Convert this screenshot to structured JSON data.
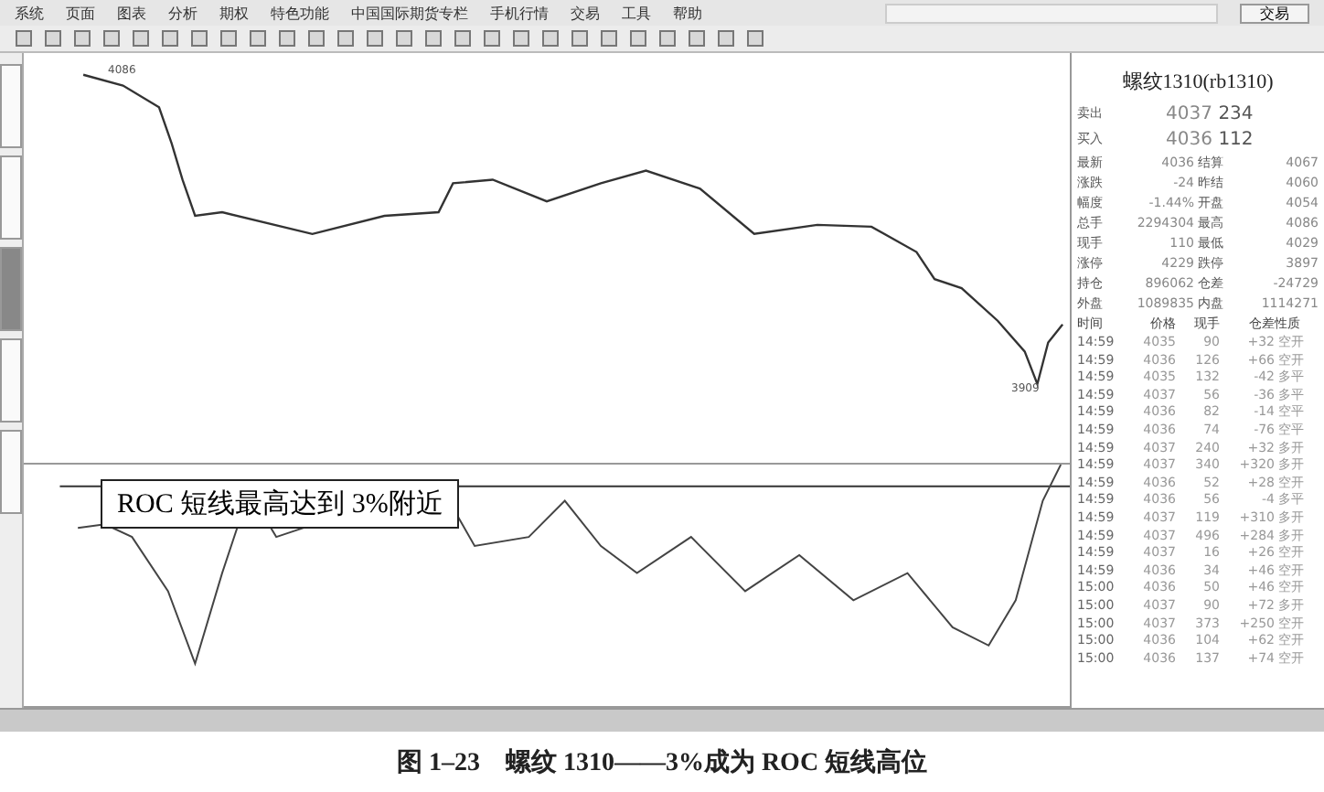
{
  "menu": [
    "系统",
    "页面",
    "图表",
    "分析",
    "期权",
    "特色功能",
    "中国国际期货专栏",
    "手机行情",
    "交易",
    "工具",
    "帮助"
  ],
  "trade_button": "交易",
  "side_tabs": [
    {
      "selected": false
    },
    {
      "selected": false
    },
    {
      "selected": true
    },
    {
      "selected": false
    },
    {
      "selected": false
    }
  ],
  "chart": {
    "high_label": "4086",
    "low_label": "3909",
    "annotation": "ROC 短线最高达到 3%附近"
  },
  "quote": {
    "title": "螺纹1310(rb1310)",
    "asks": [
      {
        "label": "卖出",
        "price": "4037",
        "volume": "234"
      },
      {
        "label": "买入",
        "price": "4036",
        "volume": "112"
      }
    ],
    "fields": [
      [
        "最新",
        "4036",
        "结算",
        "4067"
      ],
      [
        "涨跌",
        "-24",
        "昨结",
        "4060"
      ],
      [
        "幅度",
        "-1.44%",
        "开盘",
        "4054"
      ],
      [
        "总手",
        "2294304",
        "最高",
        "4086"
      ],
      [
        "现手",
        "110",
        "最低",
        "4029"
      ],
      [
        "涨停",
        "4229",
        "跌停",
        "3897"
      ],
      [
        "持仓",
        "896062",
        "仓差",
        "-24729"
      ],
      [
        "外盘",
        "1089835",
        "内盘",
        "1114271"
      ]
    ],
    "trade_columns": [
      "时间",
      "价格",
      "现手",
      "仓差",
      "性质"
    ],
    "trades": [
      [
        "14:59",
        "4035",
        "90",
        "+32",
        "空开"
      ],
      [
        "14:59",
        "4036",
        "126",
        "+66",
        "空开"
      ],
      [
        "14:59",
        "4035",
        "132",
        "-42",
        "多平"
      ],
      [
        "14:59",
        "4037",
        "56",
        "-36",
        "多平"
      ],
      [
        "14:59",
        "4036",
        "82",
        "-14",
        "空平"
      ],
      [
        "14:59",
        "4036",
        "74",
        "-76",
        "空平"
      ],
      [
        "14:59",
        "4037",
        "240",
        "+32",
        "多开"
      ],
      [
        "14:59",
        "4037",
        "340",
        "+320",
        "多开"
      ],
      [
        "14:59",
        "4036",
        "52",
        "+28",
        "空开"
      ],
      [
        "14:59",
        "4036",
        "56",
        "-4",
        "多平"
      ],
      [
        "14:59",
        "4037",
        "119",
        "+310",
        "多开"
      ],
      [
        "14:59",
        "4037",
        "496",
        "+284",
        "多开"
      ],
      [
        "14:59",
        "4037",
        "16",
        "+26",
        "空开"
      ],
      [
        "14:59",
        "4036",
        "34",
        "+46",
        "空开"
      ],
      [
        "15:00",
        "4036",
        "50",
        "+46",
        "空开"
      ],
      [
        "15:00",
        "4037",
        "90",
        "+72",
        "多开"
      ],
      [
        "15:00",
        "4037",
        "373",
        "+250",
        "空开"
      ],
      [
        "15:00",
        "4036",
        "104",
        "+62",
        "空开"
      ],
      [
        "15:00",
        "4036",
        "137",
        "+74",
        "空开"
      ]
    ]
  },
  "caption": "图 1–23　螺纹 1310——3%成为 ROC 短线高位"
}
